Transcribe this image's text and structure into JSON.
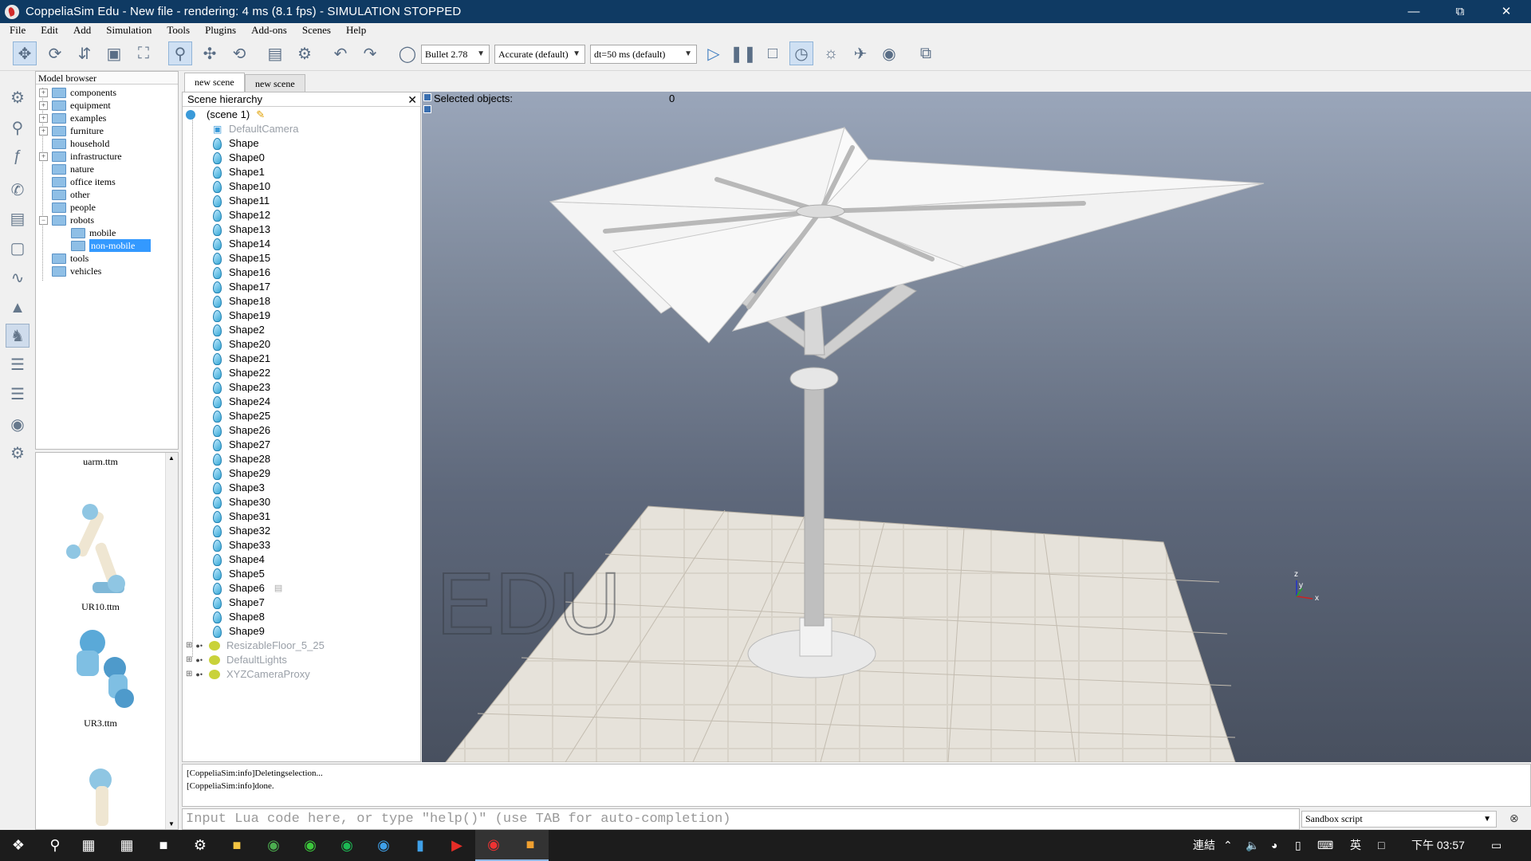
{
  "window": {
    "title": "CoppeliaSim Edu - New file - rendering: 4 ms (8.1 fps) - SIMULATION STOPPED"
  },
  "menu": [
    "File",
    "Edit",
    "Add",
    "Simulation",
    "Tools",
    "Plugins",
    "Add-ons",
    "Scenes",
    "Help"
  ],
  "toolbar": {
    "engine": "Bullet 2.78",
    "accuracy": "Accurate (default)",
    "timestep": "dt=50 ms (default)"
  },
  "model_browser": {
    "title": "Model browser",
    "items": [
      {
        "label": "components",
        "expandable": true
      },
      {
        "label": "equipment",
        "expandable": true
      },
      {
        "label": "examples",
        "expandable": true
      },
      {
        "label": "furniture",
        "expandable": true
      },
      {
        "label": "household",
        "expandable": false
      },
      {
        "label": "infrastructure",
        "expandable": true
      },
      {
        "label": "nature",
        "expandable": false
      },
      {
        "label": "office items",
        "expandable": false
      },
      {
        "label": "other",
        "expandable": false
      },
      {
        "label": "people",
        "expandable": false
      },
      {
        "label": "robots",
        "expandable": true,
        "expanded": true
      },
      {
        "label": "mobile",
        "expandable": false,
        "child": true
      },
      {
        "label": "non-mobile",
        "expandable": false,
        "child": true,
        "selected": true
      },
      {
        "label": "tools",
        "expandable": false
      },
      {
        "label": "vehicles",
        "expandable": false
      }
    ],
    "thumbnails": [
      "uarm.ttm",
      "UR10.ttm",
      "UR3.ttm"
    ]
  },
  "scene_tabs": [
    "new scene",
    "new scene"
  ],
  "hierarchy": {
    "title": "Scene hierarchy",
    "root": "(scene 1)",
    "items": [
      "DefaultCamera",
      "Shape",
      "Shape0",
      "Shape1",
      "Shape10",
      "Shape11",
      "Shape12",
      "Shape13",
      "Shape14",
      "Shape15",
      "Shape16",
      "Shape17",
      "Shape18",
      "Shape19",
      "Shape2",
      "Shape20",
      "Shape21",
      "Shape22",
      "Shape23",
      "Shape24",
      "Shape25",
      "Shape26",
      "Shape27",
      "Shape28",
      "Shape29",
      "Shape3",
      "Shape30",
      "Shape31",
      "Shape32",
      "Shape33",
      "Shape4",
      "Shape5",
      "Shape6",
      "Shape7",
      "Shape8",
      "Shape9"
    ],
    "bottom_items": [
      "ResizableFloor_5_25",
      "DefaultLights",
      "XYZCameraProxy"
    ]
  },
  "viewport": {
    "selected_label": "Selected objects:",
    "selected_count": "0",
    "watermark": "EDU",
    "axes": {
      "z": "z",
      "y": "y",
      "x": "x"
    }
  },
  "console": {
    "lines": [
      "[CoppeliaSim:info]Deletingselection...",
      "[CoppeliaSim:info]done."
    ]
  },
  "commandline": {
    "placeholder": "Input Lua code here, or type \"help()\" (use TAB for auto-completion)",
    "script": "Sandbox script"
  },
  "taskbar": {
    "tray_network": "連結",
    "ime": "英",
    "clock": "下午 03:57"
  }
}
